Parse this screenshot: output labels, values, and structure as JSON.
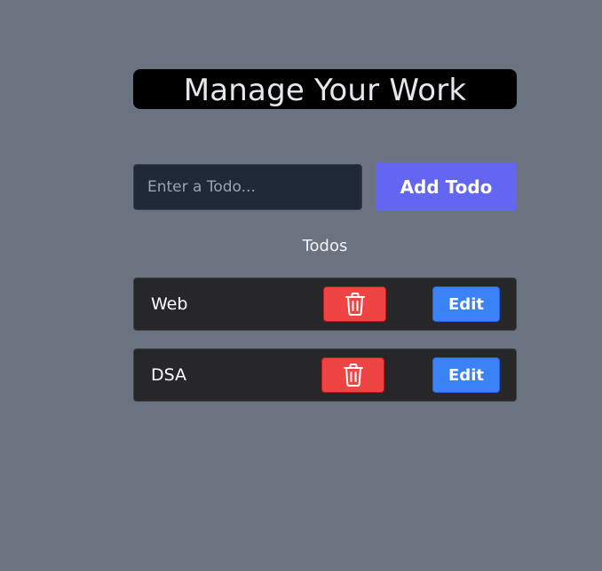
{
  "header": {
    "title": "Manage Your Work"
  },
  "form": {
    "input_placeholder": "Enter a Todo...",
    "input_value": "",
    "add_button_label": "Add Todo"
  },
  "todos": {
    "heading": "Todos",
    "items": [
      {
        "text": "Web",
        "delete_icon": "trash-icon",
        "edit_label": "Edit"
      },
      {
        "text": "DSA",
        "delete_icon": "trash-icon",
        "edit_label": "Edit"
      }
    ]
  },
  "colors": {
    "background": "#6b7280",
    "title_background": "#000000",
    "add_button": "#6366f1",
    "delete_button": "#ef4444",
    "edit_button": "#3b82f6",
    "item_background": "#27272a"
  }
}
